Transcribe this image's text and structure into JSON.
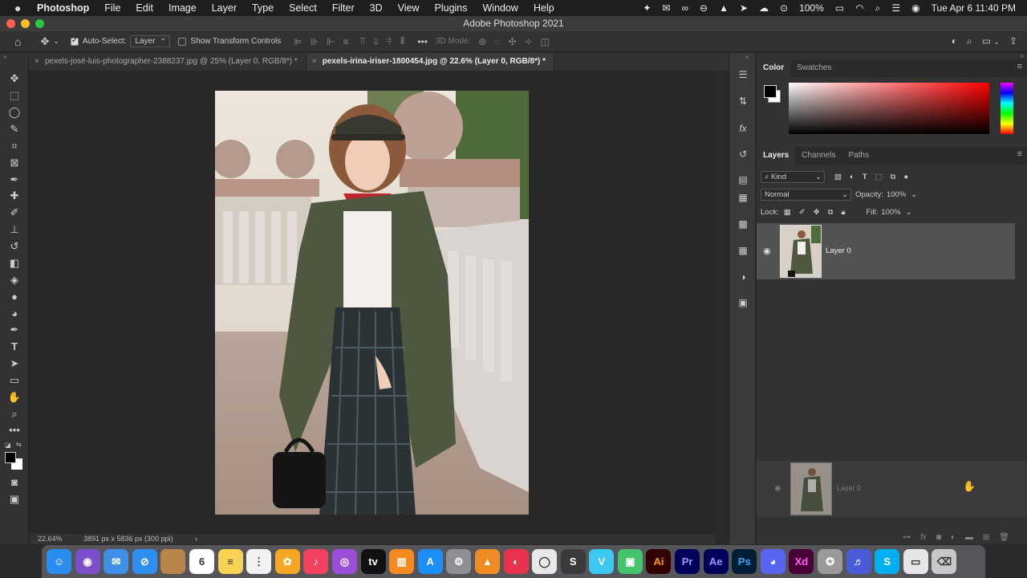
{
  "menubar": {
    "app": "Photoshop",
    "items": [
      "File",
      "Edit",
      "Image",
      "Layer",
      "Type",
      "Select",
      "Filter",
      "3D",
      "View",
      "Plugins",
      "Window",
      "Help"
    ],
    "battery": "100%",
    "clock": "Tue Apr 6  11:40 PM"
  },
  "window": {
    "title": "Adobe Photoshop 2021"
  },
  "options": {
    "auto_select_label": "Auto-Select:",
    "auto_select_value": "Layer",
    "transform_label": "Show Transform Controls",
    "mode_label": "3D Mode:"
  },
  "tabs": [
    {
      "label": "pexels-josé-luis-photographer-2388237.jpg @ 25% (Layer 0, RGB/8*) *",
      "active": false
    },
    {
      "label": "pexels-irina-iriser-1800454.jpg @ 22.6% (Layer 0, RGB/8*) *",
      "active": true
    }
  ],
  "status": {
    "zoom": "22.64%",
    "doc_info": "3891 px x 5836 px (300 ppi)"
  },
  "color_panel": {
    "tabs": [
      "Color",
      "Swatches"
    ],
    "foreground": "#000000",
    "background": "#ffffff"
  },
  "layers_panel": {
    "tabs": [
      "Layers",
      "Channels",
      "Paths"
    ],
    "filter_kind": "Kind",
    "blend_mode": "Normal",
    "opacity_label": "Opacity:",
    "opacity_value": "100%",
    "lock_label": "Lock:",
    "fill_label": "Fill:",
    "fill_value": "100%",
    "layers": [
      {
        "name": "Layer 0",
        "visible": true
      }
    ],
    "drag_ghost_label": "Layer 0"
  },
  "dock": {
    "apps": [
      {
        "name": "finder",
        "color": "#2a8df0",
        "glyph": "☺"
      },
      {
        "name": "siri",
        "color": "#7a4fc9",
        "glyph": "◉"
      },
      {
        "name": "mail",
        "color": "#3d8fe8",
        "glyph": "✉"
      },
      {
        "name": "safari",
        "color": "#2f8ff0",
        "glyph": "⊘"
      },
      {
        "name": "notes-brown",
        "color": "#b8864a",
        "glyph": ""
      },
      {
        "name": "calendar",
        "color": "#ffffff",
        "glyph": "6"
      },
      {
        "name": "notes",
        "color": "#f7d353",
        "glyph": "≡"
      },
      {
        "name": "reminders",
        "color": "#f2f2f2",
        "glyph": "⋮"
      },
      {
        "name": "photos",
        "color": "#f5a623",
        "glyph": "✿"
      },
      {
        "name": "music",
        "color": "#f3425f",
        "glyph": "♪"
      },
      {
        "name": "podcasts",
        "color": "#9b4fd8",
        "glyph": "◎"
      },
      {
        "name": "tv",
        "color": "#111111",
        "glyph": "tv"
      },
      {
        "name": "books",
        "color": "#f58a21",
        "glyph": "▥"
      },
      {
        "name": "app-store",
        "color": "#1c8ef5",
        "glyph": "A"
      },
      {
        "name": "system-preferences",
        "color": "#8e8e93",
        "glyph": "⚙"
      },
      {
        "name": "vlc",
        "color": "#f08a24",
        "glyph": "▲"
      },
      {
        "name": "screen-recorder",
        "color": "#e8324e",
        "glyph": "◐"
      },
      {
        "name": "chrome",
        "color": "#e8e8e8",
        "glyph": "◯"
      },
      {
        "name": "app-dark",
        "color": "#3a3a3a",
        "glyph": "S"
      },
      {
        "name": "filmora",
        "color": "#3cc8f0",
        "glyph": "V"
      },
      {
        "name": "app-green",
        "color": "#43c46a",
        "glyph": "▣"
      },
      {
        "name": "illustrator",
        "color": "#330000",
        "glyph": "Ai",
        "fg": "#ff9a00"
      },
      {
        "name": "premiere",
        "color": "#00005b",
        "glyph": "Pr",
        "fg": "#9999ff"
      },
      {
        "name": "after-effects",
        "color": "#00005b",
        "glyph": "Ae",
        "fg": "#9999ff"
      },
      {
        "name": "photoshop",
        "color": "#001e36",
        "glyph": "Ps",
        "fg": "#31a8ff"
      },
      {
        "name": "discord",
        "color": "#5865f2",
        "glyph": "◕"
      },
      {
        "name": "xd",
        "color": "#470137",
        "glyph": "Xd",
        "fg": "#ff61f6"
      },
      {
        "name": "automator",
        "color": "#9a9a9a",
        "glyph": "✪"
      },
      {
        "name": "headphones",
        "color": "#4a5bd8",
        "glyph": "♬"
      },
      {
        "name": "skype",
        "color": "#00aff0",
        "glyph": "S"
      },
      {
        "name": "preview",
        "color": "#e6e6e6",
        "glyph": "▭"
      },
      {
        "name": "trash",
        "color": "#c8c8c8",
        "glyph": "⌫"
      }
    ]
  }
}
